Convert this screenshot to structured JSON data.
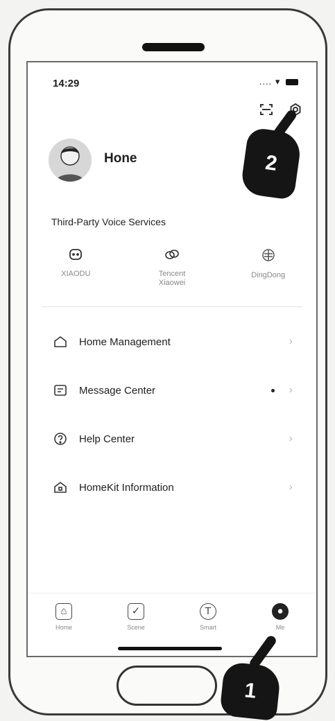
{
  "status_bar": {
    "time": "14:29"
  },
  "profile": {
    "name": "Hone"
  },
  "voice_services": {
    "title": "Third-Party Voice Services",
    "items": [
      {
        "label": "XIAODU",
        "icon": "xiaodu-icon"
      },
      {
        "label": "Tencent\nXiaowei",
        "icon": "tencent-xiaowei-icon"
      },
      {
        "label": "DingDong",
        "icon": "dingdong-icon"
      }
    ]
  },
  "menu": {
    "items": [
      {
        "label": "Home Management",
        "icon": "home-outline-icon"
      },
      {
        "label": "Message Center",
        "icon": "message-icon"
      },
      {
        "label": "Help Center",
        "icon": "help-icon"
      },
      {
        "label": "HomeKit Information",
        "icon": "homekit-icon"
      }
    ]
  },
  "tabbar": {
    "items": [
      {
        "label": "Home"
      },
      {
        "label": "Scene"
      },
      {
        "label": "Smart"
      },
      {
        "label": "Me"
      }
    ]
  },
  "annotations": {
    "step1": "1",
    "step2": "2"
  }
}
